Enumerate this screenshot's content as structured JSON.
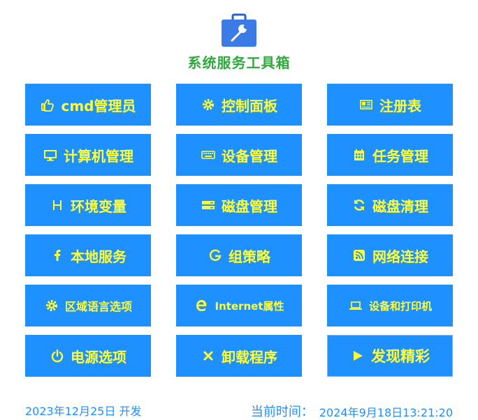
{
  "app": {
    "title": "系统服务工具箱",
    "logo_icon": "briefcase-wrench-icon"
  },
  "theme": {
    "tile_bg": "#1e90ff",
    "tile_text": "#ffff33",
    "title_color": "#2eaa3c",
    "footer_text": "#1e90ff"
  },
  "tiles": [
    {
      "label": "cmd管理员",
      "icon": "thumbs-up-icon"
    },
    {
      "label": "控制面板",
      "icon": "gear-icon"
    },
    {
      "label": "注册表",
      "icon": "newspaper-icon"
    },
    {
      "label": "计算机管理",
      "icon": "monitor-icon"
    },
    {
      "label": "设备管理",
      "icon": "keyboard-icon"
    },
    {
      "label": "任务管理",
      "icon": "calendar-icon"
    },
    {
      "label": "环境变量",
      "icon": "letter-h-icon"
    },
    {
      "label": "磁盘管理",
      "icon": "disk-icon"
    },
    {
      "label": "磁盘清理",
      "icon": "refresh-icon"
    },
    {
      "label": "本地服务",
      "icon": "facebook-f-icon"
    },
    {
      "label": "组策略",
      "icon": "letter-g-icon"
    },
    {
      "label": "网络连接",
      "icon": "rss-icon"
    },
    {
      "label": "区域语言选项",
      "icon": "gear-icon"
    },
    {
      "label": "Internet属性",
      "icon": "edge-icon"
    },
    {
      "label": "设备和打印机",
      "icon": "laptop-icon"
    },
    {
      "label": "电源选项",
      "icon": "power-icon"
    },
    {
      "label": "卸载程序",
      "icon": "close-icon"
    },
    {
      "label": "发现精彩",
      "icon": "play-icon"
    }
  ],
  "footer": {
    "build_info": "2023年12月25日 开发",
    "clock_label": "当前时间：",
    "clock_value": "2024年9月18日13:21:20"
  }
}
